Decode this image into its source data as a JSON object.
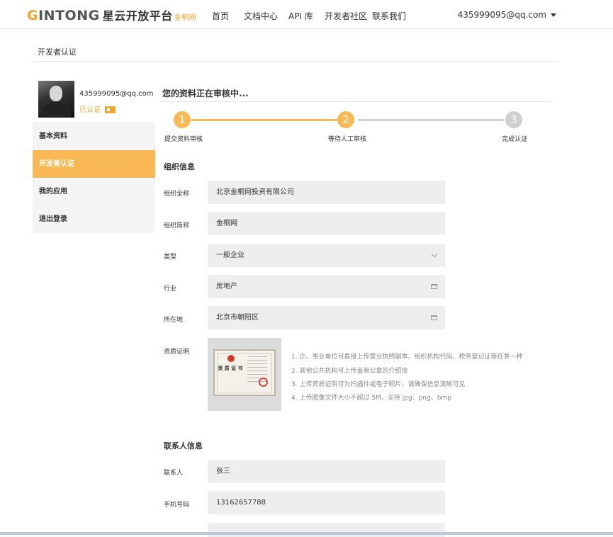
{
  "header": {
    "logo_brand_first": "G",
    "logo_brand_rest": "INTONG",
    "logo_cn": "星云开放平台",
    "logo_sub": "金桐网",
    "nav": [
      "首页",
      "文档中心",
      "API 库",
      "开发者社区",
      "联系我们"
    ],
    "user_email": "435999095@qq.com"
  },
  "page": {
    "title": "开发者认证"
  },
  "sidebar": {
    "profile_email": "435999095@qq.com",
    "verified_label": "已认证",
    "items": [
      {
        "label": "基本资料",
        "active": false
      },
      {
        "label": "开发者认证",
        "active": true
      },
      {
        "label": "我的应用",
        "active": false
      },
      {
        "label": "退出登录",
        "active": false
      }
    ]
  },
  "main": {
    "heading": "您的资料正在审核中...",
    "steps": [
      {
        "number": "1",
        "label": "提交资料审核",
        "state": "done"
      },
      {
        "number": "2",
        "label": "等待人工审核",
        "state": "done"
      },
      {
        "number": "3",
        "label": "完成认证",
        "state": "todo"
      }
    ],
    "org_section_title": "组织信息",
    "org_fields": [
      {
        "label": "组织全称",
        "value": "北京金桐网投资有限公司",
        "control": "text"
      },
      {
        "label": "组织简称",
        "value": "金桐网",
        "control": "text"
      },
      {
        "label": "类型",
        "value": "一般企业",
        "control": "select"
      },
      {
        "label": "行业",
        "value": "房地产",
        "control": "picker"
      },
      {
        "label": "所在地",
        "value": "北京市朝阳区",
        "control": "picker"
      }
    ],
    "cert_label": "资质证明",
    "cert_image_text": "资 质 证 书",
    "cert_hints": [
      "1. 企、事业单位可直接上传营业执照副本、组织机构代码、税务登记证等任意一种",
      "2. 其他公共机构可上传盖有公章的介绍信",
      "3. 上传资质证明可为扫描件或电子照片，请确保信息清晰可见",
      "4. 上传图像文件大小不超过 5M，支持 jpg、png、bmp"
    ],
    "contact_section_title": "联系人信息",
    "contact_fields": [
      {
        "label": "联系人",
        "value": "张三"
      },
      {
        "label": "手机号码",
        "value": "13162657788"
      }
    ]
  },
  "colors": {
    "accent": "#f8b955",
    "brand": "#f0a52d",
    "inactive_step": "#cfcfcf",
    "field_bg": "#eeeeee"
  }
}
